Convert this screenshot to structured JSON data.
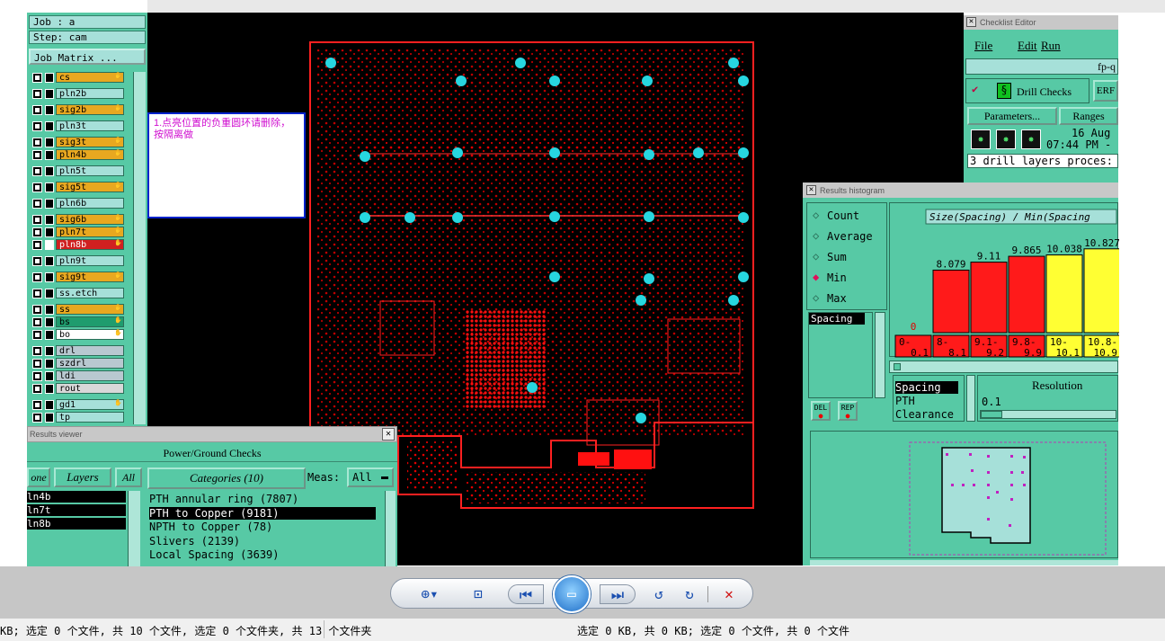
{
  "left_panel": {
    "job_label": "Job : a",
    "step_label": "Step: cam",
    "job_matrix_button": "Job Matrix ...",
    "layers": [
      {
        "name": "cs",
        "color": "#e8a820",
        "hand": true
      },
      {
        "name": "pln2b",
        "color": "#a6e0d9",
        "hand": false
      },
      {
        "name": "sig2b",
        "color": "#e8a820",
        "hand": true
      },
      {
        "name": "pln3t",
        "color": "#a6e0d9",
        "hand": false
      },
      {
        "name": "sig3t",
        "color": "#e8a820",
        "hand": true
      },
      {
        "name": "pln4b",
        "color": "#e8a820",
        "hand": true
      },
      {
        "name": "pln5t",
        "color": "#a6e0d9",
        "hand": false
      },
      {
        "name": "sig5t",
        "color": "#e8a820",
        "hand": true
      },
      {
        "name": "pln6b",
        "color": "#a6e0d9",
        "hand": false
      },
      {
        "name": "sig6b",
        "color": "#e8a820",
        "hand": true
      },
      {
        "name": "pln7t",
        "color": "#e8a820",
        "hand": true
      },
      {
        "name": "pln8b",
        "color": "#d02020",
        "hand": true
      },
      {
        "name": "pln9t",
        "color": "#a6e0d9",
        "hand": false
      },
      {
        "name": "sig9t",
        "color": "#e8a820",
        "hand": true
      },
      {
        "name": "ss.etch",
        "color": "#a6e0d9",
        "hand": false
      },
      {
        "name": "ss",
        "color": "#e8a820",
        "hand": true
      },
      {
        "name": "bs",
        "color": "#1f9c6e",
        "hand": true
      },
      {
        "name": "bo",
        "color": "#ffffff",
        "hand": true
      },
      {
        "name": "drl",
        "color": "#b8c8d0",
        "hand": false
      },
      {
        "name": "szdrl",
        "color": "#b8c8d0",
        "hand": false
      },
      {
        "name": "ldi",
        "color": "#b8c8d0",
        "hand": false
      },
      {
        "name": "rout",
        "color": "#d8d8d8",
        "hand": false
      },
      {
        "name": "gd1",
        "color": "#a6e0d9",
        "hand": true
      },
      {
        "name": "tp",
        "color": "#a6e0d9",
        "hand": false
      }
    ]
  },
  "note_text": "1.点亮位置的负重圆环请删除，按隔离做",
  "results_viewer": {
    "title": "Results viewer",
    "subtitle": "Power/Ground Checks",
    "none_btn": "one",
    "layers_btn": "Layers",
    "all_btn": "All",
    "categories_btn": "Categories (10)",
    "meas_label": "Meas:",
    "meas_value": "All",
    "layer_list": [
      "ln4b",
      "ln7t",
      "ln8b"
    ],
    "categories": [
      "PTH annular ring (7807)",
      "PTH to Copper (9181)",
      "NPTH to Copper (78)",
      "Slivers (2139)",
      "Local Spacing (3639)"
    ],
    "selected_category": 1
  },
  "checklist_editor": {
    "title": "Checklist Editor",
    "menu": [
      "File",
      "Edit",
      "Run"
    ],
    "name_field": "fp-q",
    "check_name": "Drill Checks",
    "erf_btn": "ERF",
    "parameters_btn": "Parameters...",
    "ranges_btn": "Ranges",
    "date_line1": "16 Aug",
    "date_line2": "07:44 PM -",
    "status_text": "3 drill layers proces:"
  },
  "histogram": {
    "title": "Results histogram",
    "options": [
      "Count",
      "Average",
      "Sum",
      "Min",
      "Max"
    ],
    "selected_option": "Min",
    "chart_title": "Size(Spacing) / Min(Spacing",
    "list_item": "Spacing",
    "del_btn": "DEL",
    "rep_btn": "REP",
    "resolution_label": "Resolution",
    "resolution_value": "0.1",
    "legend_items": [
      "Spacing",
      "PTH",
      "Clearance"
    ]
  },
  "chart_data": {
    "type": "bar",
    "title": "Size(Spacing) / Min(Spacing",
    "categories": [
      "0-\n0.1",
      "8-\n8.1",
      "9.1-\n9.2",
      "9.8-\n9.9",
      "10-\n10.1",
      "10.8-\n10.9"
    ],
    "category_top": [
      "0-",
      "8-",
      "9.1-",
      "9.8-",
      "10-",
      "10.8-"
    ],
    "category_bottom": [
      "0.1",
      "8.1",
      "9.2",
      "9.9",
      "10.1",
      "10.9"
    ],
    "values": [
      0,
      8.079,
      9.11,
      9.865,
      10.038,
      10.827
    ],
    "value_labels": [
      "0",
      "8.079",
      "9.11",
      "9.865",
      "10.038",
      "10.827"
    ],
    "colors": [
      "#ff1a1a",
      "#ff1a1a",
      "#ff1a1a",
      "#ff1a1a",
      "#ffff33",
      "#ffff33"
    ],
    "ylim": [
      0,
      11.5
    ]
  },
  "status_bar": {
    "left": "KB; 选定 0 个文件, 共 10 个文件, 选定 0 个文件夹, 共 13 个文件夹",
    "right": "选定 0 KB, 共 0 KB; 选定 0 个文件, 共 0 个文件"
  }
}
